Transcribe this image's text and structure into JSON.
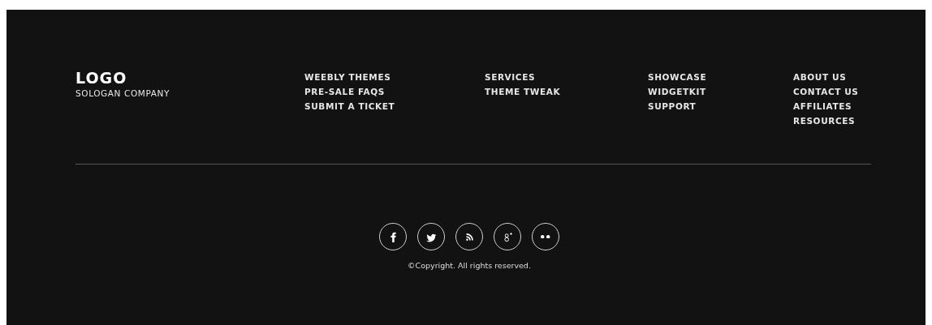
{
  "brand": {
    "logo": "LOGO",
    "slogan": "SOLOGAN COMPANY"
  },
  "link_columns": [
    {
      "links": [
        "WEEBLY THEMES",
        "PRE-SALE FAQS",
        "SUBMIT A TICKET"
      ]
    },
    {
      "links": [
        "SERVICES",
        "THEME TWEAK"
      ]
    },
    {
      "links": [
        "SHOWCASE",
        "WIDGETKIT",
        "SUPPORT"
      ]
    },
    {
      "links": [
        "ABOUT US",
        "CONTACT US",
        "AFFILIATES",
        "RESOURCES"
      ]
    }
  ],
  "social": [
    {
      "kind": "f"
    },
    {
      "kind": "bird"
    },
    {
      "kind": "rss"
    },
    {
      "kind": "gplus"
    },
    {
      "kind": "dots"
    }
  ],
  "copyright": "©Copyright. All rights reserved."
}
